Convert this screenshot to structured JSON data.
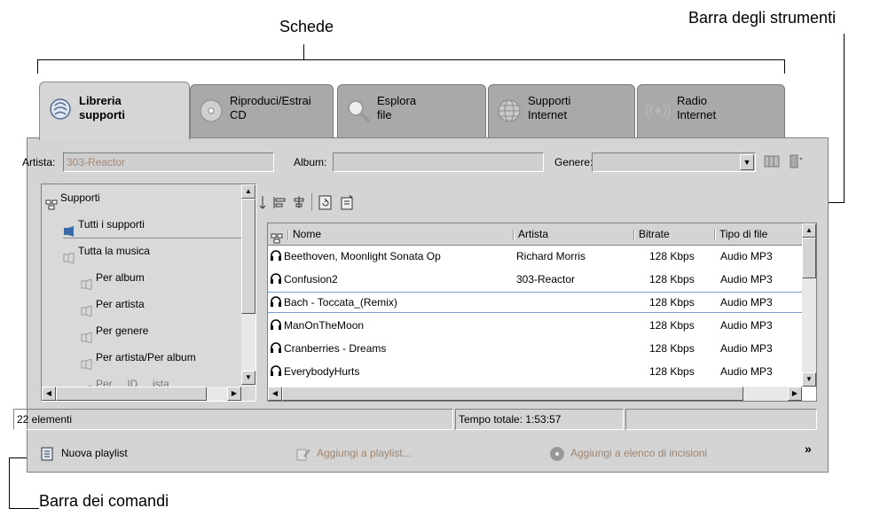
{
  "callouts": {
    "tabs": "Schede",
    "toolbar": "Barra degli strumenti",
    "commands": "Barra dei comandi"
  },
  "tabs": [
    {
      "label": "Libreria\nsupporti",
      "icon": "media-library-icon",
      "active": true
    },
    {
      "label": "Riproduci/Estrai\nCD",
      "icon": "cd-icon",
      "active": false
    },
    {
      "label": "Esplora\nfile",
      "icon": "magnifier-icon",
      "active": false
    },
    {
      "label": "Supporti\nInternet",
      "icon": "globe-icon",
      "active": false
    },
    {
      "label": "Radio\nInternet",
      "icon": "radio-icon",
      "active": false
    }
  ],
  "filters": {
    "artist_label": "Artista:",
    "artist_value": "303-Reactor",
    "album_label": "Album:",
    "album_value": "",
    "genre_label": "Genere:",
    "genre_value": ""
  },
  "tree": {
    "items": [
      {
        "label": "Supporti",
        "icon": "network-icon",
        "level": 0
      },
      {
        "label": "Tutti i supporti",
        "icon": "music-all-icon",
        "level": 1,
        "selected": true
      },
      {
        "label": "Tutta la musica",
        "icon": "music-icon",
        "level": 1
      },
      {
        "label": "Per album",
        "icon": "music-icon",
        "level": 2
      },
      {
        "label": "Per artista",
        "icon": "music-icon",
        "level": 2
      },
      {
        "label": "Per genere",
        "icon": "music-icon",
        "level": 2
      },
      {
        "label": "Per artista/Per album",
        "icon": "music-icon",
        "level": 2
      },
      {
        "label": "Per ... ID ... ista",
        "icon": "music-icon",
        "level": 2
      }
    ]
  },
  "list": {
    "columns": [
      "Nome",
      "Artista",
      "Bitrate",
      "Tipo di file"
    ],
    "rows": [
      {
        "nome": "Beethoven, Moonlight Sonata Op",
        "artista": "Richard Morris",
        "bitrate": "128 Kbps",
        "tipo": "Audio MP3"
      },
      {
        "nome": "Confusion2",
        "artista": "303-Reactor",
        "bitrate": "128 Kbps",
        "tipo": "Audio MP3"
      },
      {
        "nome": "Bach - Toccata_(Remix)",
        "artista": "",
        "bitrate": "128 Kbps",
        "tipo": "Audio MP3",
        "selected": true
      },
      {
        "nome": "ManOnTheMoon",
        "artista": "",
        "bitrate": "128 Kbps",
        "tipo": "Audio MP3"
      },
      {
        "nome": "Cranberries - Dreams",
        "artista": "",
        "bitrate": "128 Kbps",
        "tipo": "Audio MP3"
      },
      {
        "nome": "EverybodyHurts",
        "artista": "",
        "bitrate": "128 Kbps",
        "tipo": "Audio MP3"
      }
    ]
  },
  "status": {
    "count": "22 elementi",
    "total_time": "Tempo totale: 1:53:57",
    "extra": ""
  },
  "commands": {
    "new_playlist": "Nuova playlist",
    "add_to_playlist": "Aggiungi a playlist...",
    "add_to_burn": "Aggiungi a elenco di incisioni",
    "more": "»"
  },
  "colors": {
    "disabled_text": "#a0856e",
    "selection_border": "#7aa0d0",
    "tab_inactive": "#a9a9a9",
    "window_bg": "#d4d4d4"
  }
}
